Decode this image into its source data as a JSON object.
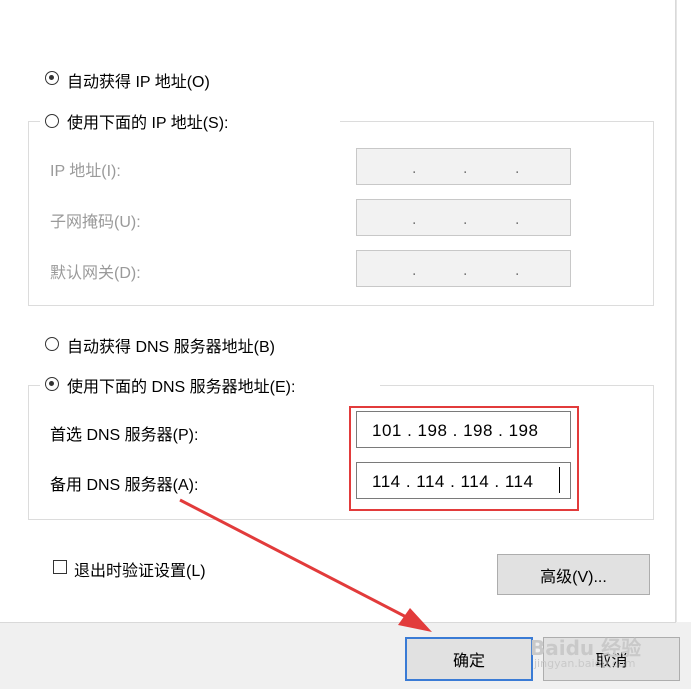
{
  "ip_section": {
    "auto_ip_label": "自动获得 IP 地址(O)",
    "manual_ip_label": "使用下面的 IP 地址(S):",
    "ip_address_label": "IP 地址(I):",
    "subnet_label": "子网掩码(U):",
    "gateway_label": "默认网关(D):",
    "empty_ip_dots": ".      .      ."
  },
  "dns_section": {
    "auto_dns_label": "自动获得 DNS 服务器地址(B)",
    "manual_dns_label": "使用下面的 DNS 服务器地址(E):",
    "preferred_label": "首选 DNS 服务器(P):",
    "preferred_value": "101 . 198 . 198 . 198",
    "alternate_label": "备用 DNS 服务器(A):",
    "alternate_value": "114 . 114 . 114 . 114"
  },
  "validate_label": "退出时验证设置(L)",
  "buttons": {
    "advanced": "高级(V)...",
    "ok": "确定",
    "cancel": "取消"
  },
  "watermark": {
    "brand": "Baidu 经验",
    "url": "jingyan.baidu.com"
  },
  "colors": {
    "highlight": "#e23b3b",
    "arrow": "#e23b3b",
    "ok_border": "#3a7bd5"
  }
}
